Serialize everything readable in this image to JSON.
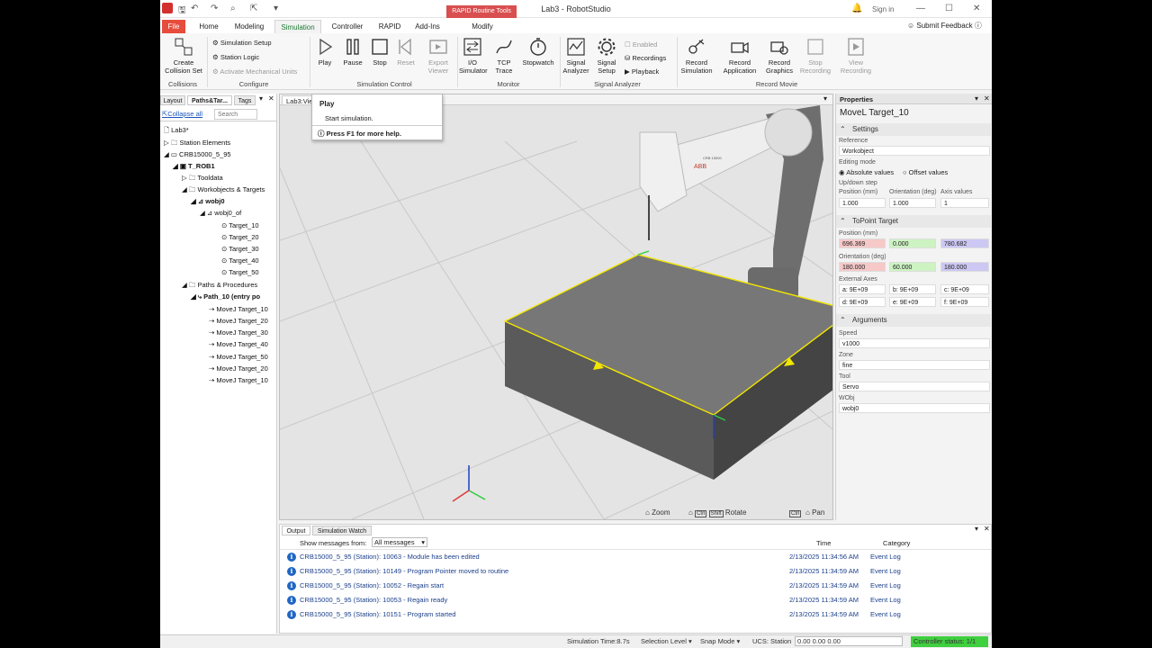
{
  "window": {
    "title": "Lab3 - RobotStudio",
    "context_tab": "RAPID Routine Tools",
    "sign_in": "Sign in",
    "submit_feedback": "Submit Feedback"
  },
  "tabs": [
    "File",
    "Home",
    "Modeling",
    "Simulation",
    "Controller",
    "RAPID",
    "Add-Ins",
    "Modify"
  ],
  "ribbon": {
    "collisions": {
      "button": "Create Collision Set",
      "group": "Collisions"
    },
    "configure": {
      "items": [
        "Simulation Setup",
        "Station Logic",
        "Activate Mechanical Units"
      ],
      "group": "Configure"
    },
    "sim_control": {
      "buttons": [
        "Play",
        "Pause",
        "Stop",
        "Reset"
      ],
      "group": "Simulation Control"
    },
    "export_viewer": "Export Viewer",
    "monitor": {
      "buttons": [
        "I/O Simulator",
        "TCP Trace",
        "Stopwatch"
      ],
      "group": "Monitor"
    },
    "signal": {
      "buttons": [
        "Signal Analyzer",
        "Signal Setup"
      ],
      "small": [
        "Enabled",
        "Recordings",
        "Playback"
      ],
      "group": "Signal Analyzer"
    },
    "record": {
      "buttons": [
        "Record Simulation",
        "Record Application",
        "Record Graphics",
        "Stop Recording",
        "View Recording"
      ],
      "group": "Record Movie"
    }
  },
  "tooltip": {
    "title": "Play",
    "body": "Start simulation.",
    "help": "Press F1 for more help."
  },
  "left_panel": {
    "tabs": [
      "Layout",
      "Paths&Tar...",
      "Tags"
    ],
    "collapse_all": "Collapse all",
    "search_placeholder": "Search",
    "tree": [
      "Lab3*",
      "Station Elements",
      "CRB15000_5_95",
      "T_ROB1",
      "Tooldata",
      "Workobjects & Targets",
      "wobj0",
      "wobj0_of",
      "Target_10",
      "Target_20",
      "Target_30",
      "Target_40",
      "Target_50",
      "Paths & Procedures",
      "Path_10 (entry po",
      "MoveJ Target_10",
      "MoveJ Target_20",
      "MoveJ Target_30",
      "MoveJ Target_40",
      "MoveJ Target_50",
      "MoveJ Target_20",
      "MoveJ Target_10"
    ]
  },
  "viewport": {
    "tab": "Lab3:View1",
    "zoom": "Zoom",
    "rotate": "Rotate",
    "pan": "Pan",
    "ctrl": "Ctrl",
    "shift": "Shift",
    "robot_brand": "ABB",
    "robot_model": "CRB 15000"
  },
  "properties": {
    "header": "Properties",
    "title": "MoveL Target_10",
    "settings": "Settings",
    "reference_label": "Reference",
    "reference": "Workobject",
    "editing_mode_label": "Editing mode",
    "absolute": "Absolute values",
    "offset": "Offset values",
    "updown_label": "Up/down step",
    "position_label": "Position (mm)",
    "orientation_label": "Orientation (deg)",
    "axis_label": "Axis values",
    "updown_values": [
      "1.000",
      "1.000",
      "1"
    ],
    "topoint": "ToPoint Target",
    "pos_label": "Position (mm)",
    "position": [
      "696.369",
      "0.000",
      "780.682"
    ],
    "ori_label": "Orientation (deg)",
    "orientation": [
      "180.000",
      "60.000",
      "180.000"
    ],
    "ext_label": "External Axes",
    "external": [
      "a: 9E+09",
      "b: 9E+09",
      "c: 9E+09",
      "d: 9E+09",
      "e: 9E+09",
      "f: 9E+09"
    ],
    "arguments": "Arguments",
    "speed_label": "Speed",
    "speed": "v1000",
    "zone_label": "Zone",
    "zone": "fine",
    "tool_label": "Tool",
    "tool": "Servo",
    "wobj_label": "WObj",
    "wobj": "wobj0"
  },
  "output": {
    "tabs": [
      "Output",
      "Simulation Watch"
    ],
    "filter_label": "Show messages from:",
    "filter_value": "All messages",
    "col_time": "Time",
    "col_category": "Category",
    "rows": [
      {
        "msg": "CRB15000_5_95 (Station): 10063 - Module has been edited",
        "time": "2/13/2025 11:34:56 AM",
        "cat": "Event Log"
      },
      {
        "msg": "CRB15000_5_95 (Station): 10149 - Program Pointer moved to routine",
        "time": "2/13/2025 11:34:59 AM",
        "cat": "Event Log"
      },
      {
        "msg": "CRB15000_5_95 (Station): 10052 - Regain start",
        "time": "2/13/2025 11:34:59 AM",
        "cat": "Event Log"
      },
      {
        "msg": "CRB15000_5_95 (Station): 10053 - Regain ready",
        "time": "2/13/2025 11:34:59 AM",
        "cat": "Event Log"
      },
      {
        "msg": "CRB15000_5_95 (Station): 10151 - Program started",
        "time": "2/13/2025 11:34:59 AM",
        "cat": "Event Log"
      }
    ]
  },
  "status": {
    "sim_time": "Simulation Time:8.7s",
    "selection": "Selection Level",
    "snap": "Snap Mode",
    "ucs_label": "UCS: Station",
    "ucs_value": "0.00  0.00  0.00",
    "controller": "Controller status: 1/1"
  },
  "colors": {
    "accent_green": "#1e7a34",
    "file_tab": "#e74c3c",
    "context_tab": "#d94f4f",
    "status_green": "#3fcf3f",
    "path_yellow": "#f2e600"
  }
}
